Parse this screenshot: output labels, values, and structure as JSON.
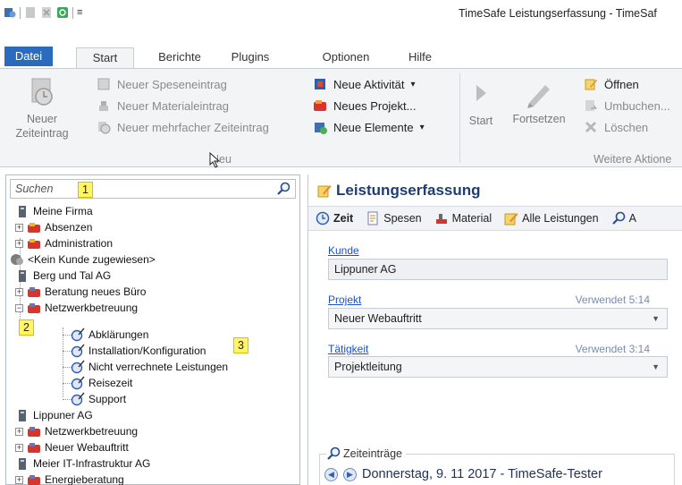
{
  "window": {
    "title": "TimeSafe Leistungserfassung - TimeSaf"
  },
  "quick_access": {
    "dropdown": "≡"
  },
  "tabs": [
    {
      "label": "Datei"
    },
    {
      "label": "Start"
    },
    {
      "label": "Berichte"
    },
    {
      "label": "Plugins"
    },
    {
      "label": "Optionen"
    },
    {
      "label": "Hilfe"
    }
  ],
  "ribbon": {
    "big_new": {
      "line1": "Neuer",
      "line2": "Zeiteintrag"
    },
    "neu_items": [
      {
        "label": "Neuer Speseneintrag"
      },
      {
        "label": "Neuer Materialeintrag"
      },
      {
        "label": "Neuer mehrfacher Zeiteintrag"
      }
    ],
    "neu_items2": [
      {
        "label": "Neue Aktivität",
        "arrow": "▾"
      },
      {
        "label": "Neues Projekt..."
      },
      {
        "label": "Neue Elemente",
        "arrow": "▾"
      }
    ],
    "group_neu": "Neu",
    "start_label": "Start",
    "fortsetzen_label": "Fortsetzen",
    "weitere_items": [
      {
        "label": "Öffnen"
      },
      {
        "label": "Umbuchen..."
      },
      {
        "label": "Löschen"
      }
    ],
    "group_weitere": "Weitere Aktione"
  },
  "search": {
    "placeholder": "Suchen"
  },
  "annotations": [
    "1",
    "2",
    "3"
  ],
  "tree": [
    {
      "label": "Meine Firma"
    },
    {
      "label": "Absenzen"
    },
    {
      "label": "Administration"
    },
    {
      "label": "<Kein Kunde zugewiesen>"
    },
    {
      "label": "Berg und Tal AG"
    },
    {
      "label": "Beratung neues Büro"
    },
    {
      "label": "Netzwerkbetreuung"
    },
    {
      "label": "Abklärungen"
    },
    {
      "label": "Installation/Konfiguration"
    },
    {
      "label": "Nicht verrechnete Leistungen"
    },
    {
      "label": "Reisezeit"
    },
    {
      "label": "Support"
    },
    {
      "label": "Lippuner AG"
    },
    {
      "label": "Netzwerkbetreuung"
    },
    {
      "label": "Neuer Webauftritt"
    },
    {
      "label": "Meier IT-Infrastruktur AG"
    },
    {
      "label": "Energieberatung"
    }
  ],
  "right": {
    "title": "Leistungserfassung",
    "tabs": [
      {
        "label": "Zeit"
      },
      {
        "label": "Spesen"
      },
      {
        "label": "Material"
      },
      {
        "label": "Alle Leistungen"
      },
      {
        "label": "A"
      }
    ],
    "kunde_label": "Kunde",
    "kunde_value": "Lippuner AG",
    "projekt_label": "Projekt",
    "projekt_used": "Verwendet 5:14",
    "projekt_value": "Neuer Webauftritt",
    "taetigkeit_label": "Tätigkeit",
    "taetigkeit_used": "Verwendet 3:14",
    "taetigkeit_value": "Projektleitung",
    "zeiteintraege_label": "Zeiteinträge",
    "zeiteintraege_date": "Donnerstag, 9. 11 2017 - TimeSafe-Tester"
  }
}
